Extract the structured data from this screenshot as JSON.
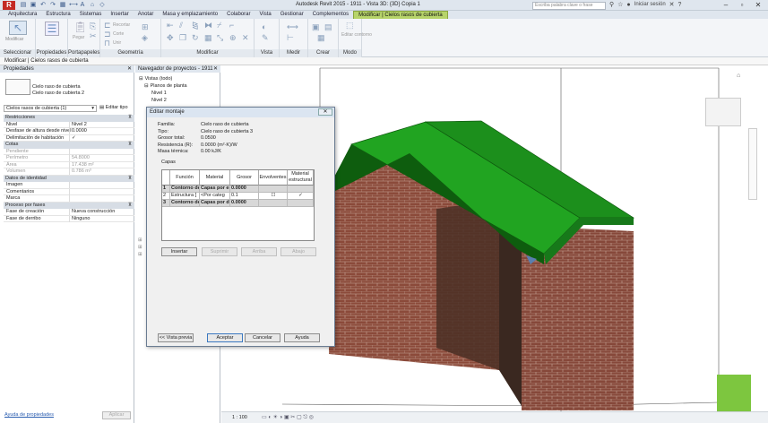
{
  "window": {
    "title": "Autodesk Revit 2015 -   1911 - Vista 3D: {3D} Copia 1",
    "logo": "R",
    "search_placeholder": "Escriba palabra clave o frase",
    "sign_in": "Iniciar sesión",
    "qat_icons": [
      "open-icon",
      "save-icon",
      "undo-icon",
      "redo-icon",
      "print-icon",
      "measure-icon",
      "text-icon",
      "3d-icon",
      "section-icon"
    ]
  },
  "ribbon": {
    "tabs": [
      "Arquitectura",
      "Estructura",
      "Sistemas",
      "Insertar",
      "Anotar",
      "Masa y emplazamiento",
      "Colaborar",
      "Vista",
      "Gestionar",
      "Complementos",
      "Modificar | Cielos rasos de cubierta"
    ],
    "active_tab_index": 10,
    "panels": {
      "select": "Seleccionar",
      "properties": "Propiedades",
      "clipboard": "Portapapeles",
      "geometry": "Geometría",
      "modify": "Modificar",
      "view": "Vista",
      "measure": "Medir",
      "create": "Crear",
      "mode": "Modo"
    },
    "buttons": {
      "modify": "Modificar",
      "paste": "Pegar",
      "cut": "Recortar",
      "cope": "Corte",
      "join": "Unir",
      "edit_boundary": "Editar contorno"
    }
  },
  "options_bar": {
    "text": "Modificar | Cielos rasos de cubierta"
  },
  "properties": {
    "title": "Propiedades",
    "type_family": "Cielo raso de cubierta",
    "type_name": "Cielo raso de cubierta 2",
    "selector": "Cielos rasos de cubierta (1)",
    "edit_type": "Editar tipo",
    "sections": [
      {
        "name": "Restricciones",
        "rows": [
          {
            "k": "Nivel",
            "v": "Nivel 2",
            "grey": false
          },
          {
            "k": "Desfase de altura desde nivel",
            "v": "0.0000",
            "grey": false
          },
          {
            "k": "Delimitación de habitación",
            "v": "✓",
            "grey": false
          }
        ]
      },
      {
        "name": "Cotas",
        "rows": [
          {
            "k": "Pendiente",
            "v": "",
            "grey": true
          },
          {
            "k": "Perímetro",
            "v": "54.8000",
            "grey": true
          },
          {
            "k": "Área",
            "v": "17.438 m²",
            "grey": true
          },
          {
            "k": "Volumen",
            "v": "0.786 m³",
            "grey": true
          }
        ]
      },
      {
        "name": "Datos de identidad",
        "rows": [
          {
            "k": "Imagen",
            "v": "",
            "grey": false
          },
          {
            "k": "Comentarios",
            "v": "",
            "grey": false
          },
          {
            "k": "Marca",
            "v": "",
            "grey": false
          }
        ]
      },
      {
        "name": "Proceso por fases",
        "rows": [
          {
            "k": "Fase de creación",
            "v": "Nueva construcción",
            "grey": false
          },
          {
            "k": "Fase de derribo",
            "v": "Ninguno",
            "grey": false
          }
        ]
      }
    ],
    "help_link": "Ayuda de propiedades",
    "apply": "Aplicar"
  },
  "browser": {
    "title": "Navegador de proyectos - 1911",
    "items": [
      {
        "label": "Vistas (todo)",
        "indent": 0,
        "sign": "⊟"
      },
      {
        "label": "Planos de planta",
        "indent": 1,
        "sign": "⊟"
      },
      {
        "label": "Nivel 1",
        "indent": 2,
        "sign": ""
      },
      {
        "label": "Nivel 2",
        "indent": 2,
        "sign": ""
      }
    ]
  },
  "dialog": {
    "title": "Editar montaje",
    "info": [
      {
        "k": "Familia:",
        "v": "Cielo raso de cubierta"
      },
      {
        "k": "Tipo:",
        "v": "Cielo raso de cubierta 3"
      },
      {
        "k": "Grosor total:",
        "v": "0.0500"
      },
      {
        "k": "Resistencia (R):",
        "v": "0.0000 (m²·K)/W"
      },
      {
        "k": "Masa térmica:",
        "v": "0.00 kJ/K"
      }
    ],
    "layers_label": "Capas",
    "columns": [
      "Función",
      "Material",
      "Grosor",
      "Envolventes",
      "Material estructural"
    ],
    "rows": [
      {
        "n": "1",
        "func": "Contorno del",
        "mat": "Capas por enc",
        "thk": "0.0000",
        "wrap": "",
        "struct": "",
        "dark": true
      },
      {
        "n": "2",
        "func": "Estructura [",
        "mat": "<Por categ",
        "thk": "0.1",
        "wrap": "☐",
        "struct": "✓",
        "dark": false
      },
      {
        "n": "3",
        "func": "Contorno del",
        "mat": "Capas por de",
        "thk": "0.0000",
        "wrap": "",
        "struct": "",
        "dark": true
      }
    ],
    "buttons": {
      "insert": "Insertar",
      "delete": "Suprimir",
      "up": "Arriba",
      "down": "Abajo",
      "preview": "<< Vista previa",
      "ok": "Aceptar",
      "cancel": "Cancelar",
      "help": "Ayuda"
    }
  },
  "status": {
    "scale": "1 : 100"
  },
  "colors": {
    "roof": "#1fa11f",
    "brick": "#8a4a38",
    "accent_tab": "#b7d46a"
  }
}
